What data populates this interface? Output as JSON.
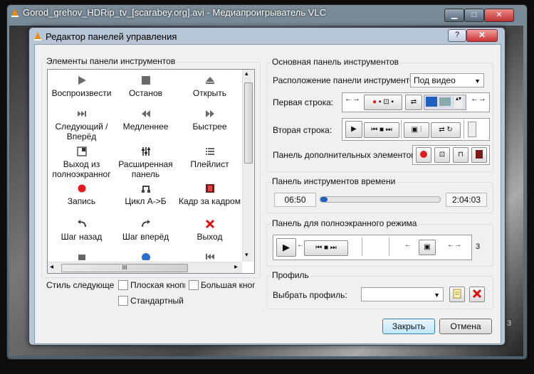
{
  "vlc": {
    "title": "Gorod_grehov_HDRip_tv_[scarabey.org].avi - Медиапроигрыватель VLC",
    "minimize": "▁",
    "maximize": "□",
    "close": "✕",
    "corner_text": "3"
  },
  "dialog": {
    "title": "Редактор панелей управления",
    "help": "?",
    "close": "✕"
  },
  "palette": {
    "title": "Элементы панели инструментов",
    "items": [
      {
        "icon": "play-icon",
        "label": "Воспроизвести"
      },
      {
        "icon": "stop-icon",
        "label": "Останов"
      },
      {
        "icon": "eject-icon",
        "label": "Открыть"
      },
      {
        "icon": "next-icon",
        "label": "Следующий / Вперёд"
      },
      {
        "icon": "slower-icon",
        "label": "Медленнее"
      },
      {
        "icon": "faster-icon",
        "label": "Быстрее"
      },
      {
        "icon": "fullscreen-icon",
        "label": "Выход из полноэкранног"
      },
      {
        "icon": "equalizer-icon",
        "label": "Расширенная панель"
      },
      {
        "icon": "playlist-icon",
        "label": "Плейлист"
      },
      {
        "icon": "record-icon",
        "label": "Запись"
      },
      {
        "icon": "loop-ab-icon",
        "label": "Цикл А->Б"
      },
      {
        "icon": "frame-icon",
        "label": "Кадр за кадром"
      },
      {
        "icon": "step-back-icon",
        "label": "Шаг назад"
      },
      {
        "icon": "step-forward-icon",
        "label": "Шаг вперёд"
      },
      {
        "icon": "quit-icon",
        "label": "Выход"
      }
    ],
    "scroll_left": "◂",
    "scroll_right": "▸",
    "scroll_up": "▴",
    "scroll_down": "▾",
    "scroll_grip": "III",
    "style_label": "Стиль следующего",
    "flat_label": "Плоская кнопк",
    "big_label": "Большая кнопк",
    "standard_label": "Стандартный"
  },
  "main_toolbar": {
    "title": "Основная панель инструментов",
    "position_label": "Расположение панели инструментов:",
    "position_value": "Под видео",
    "row1_label": "Первая строка:",
    "row2_label": "Вторая строка:",
    "extra_label": "Панель дополнительных элементов:"
  },
  "time_toolbar": {
    "title": "Панель инструментов времени",
    "elapsed": "06:50",
    "total": "2:04:03",
    "progress": 0.02
  },
  "fs_toolbar": {
    "title": "Панель для полноэкранного режима",
    "trailing": "3"
  },
  "profile": {
    "title": "Профиль",
    "select_label": "Выбрать профиль:",
    "value": ""
  },
  "buttons": {
    "close": "Закрыть",
    "cancel": "Отмена"
  },
  "colors": {
    "record": "#e11b1b",
    "delete": "#d11",
    "accent_blue": "#1e5fbf"
  }
}
